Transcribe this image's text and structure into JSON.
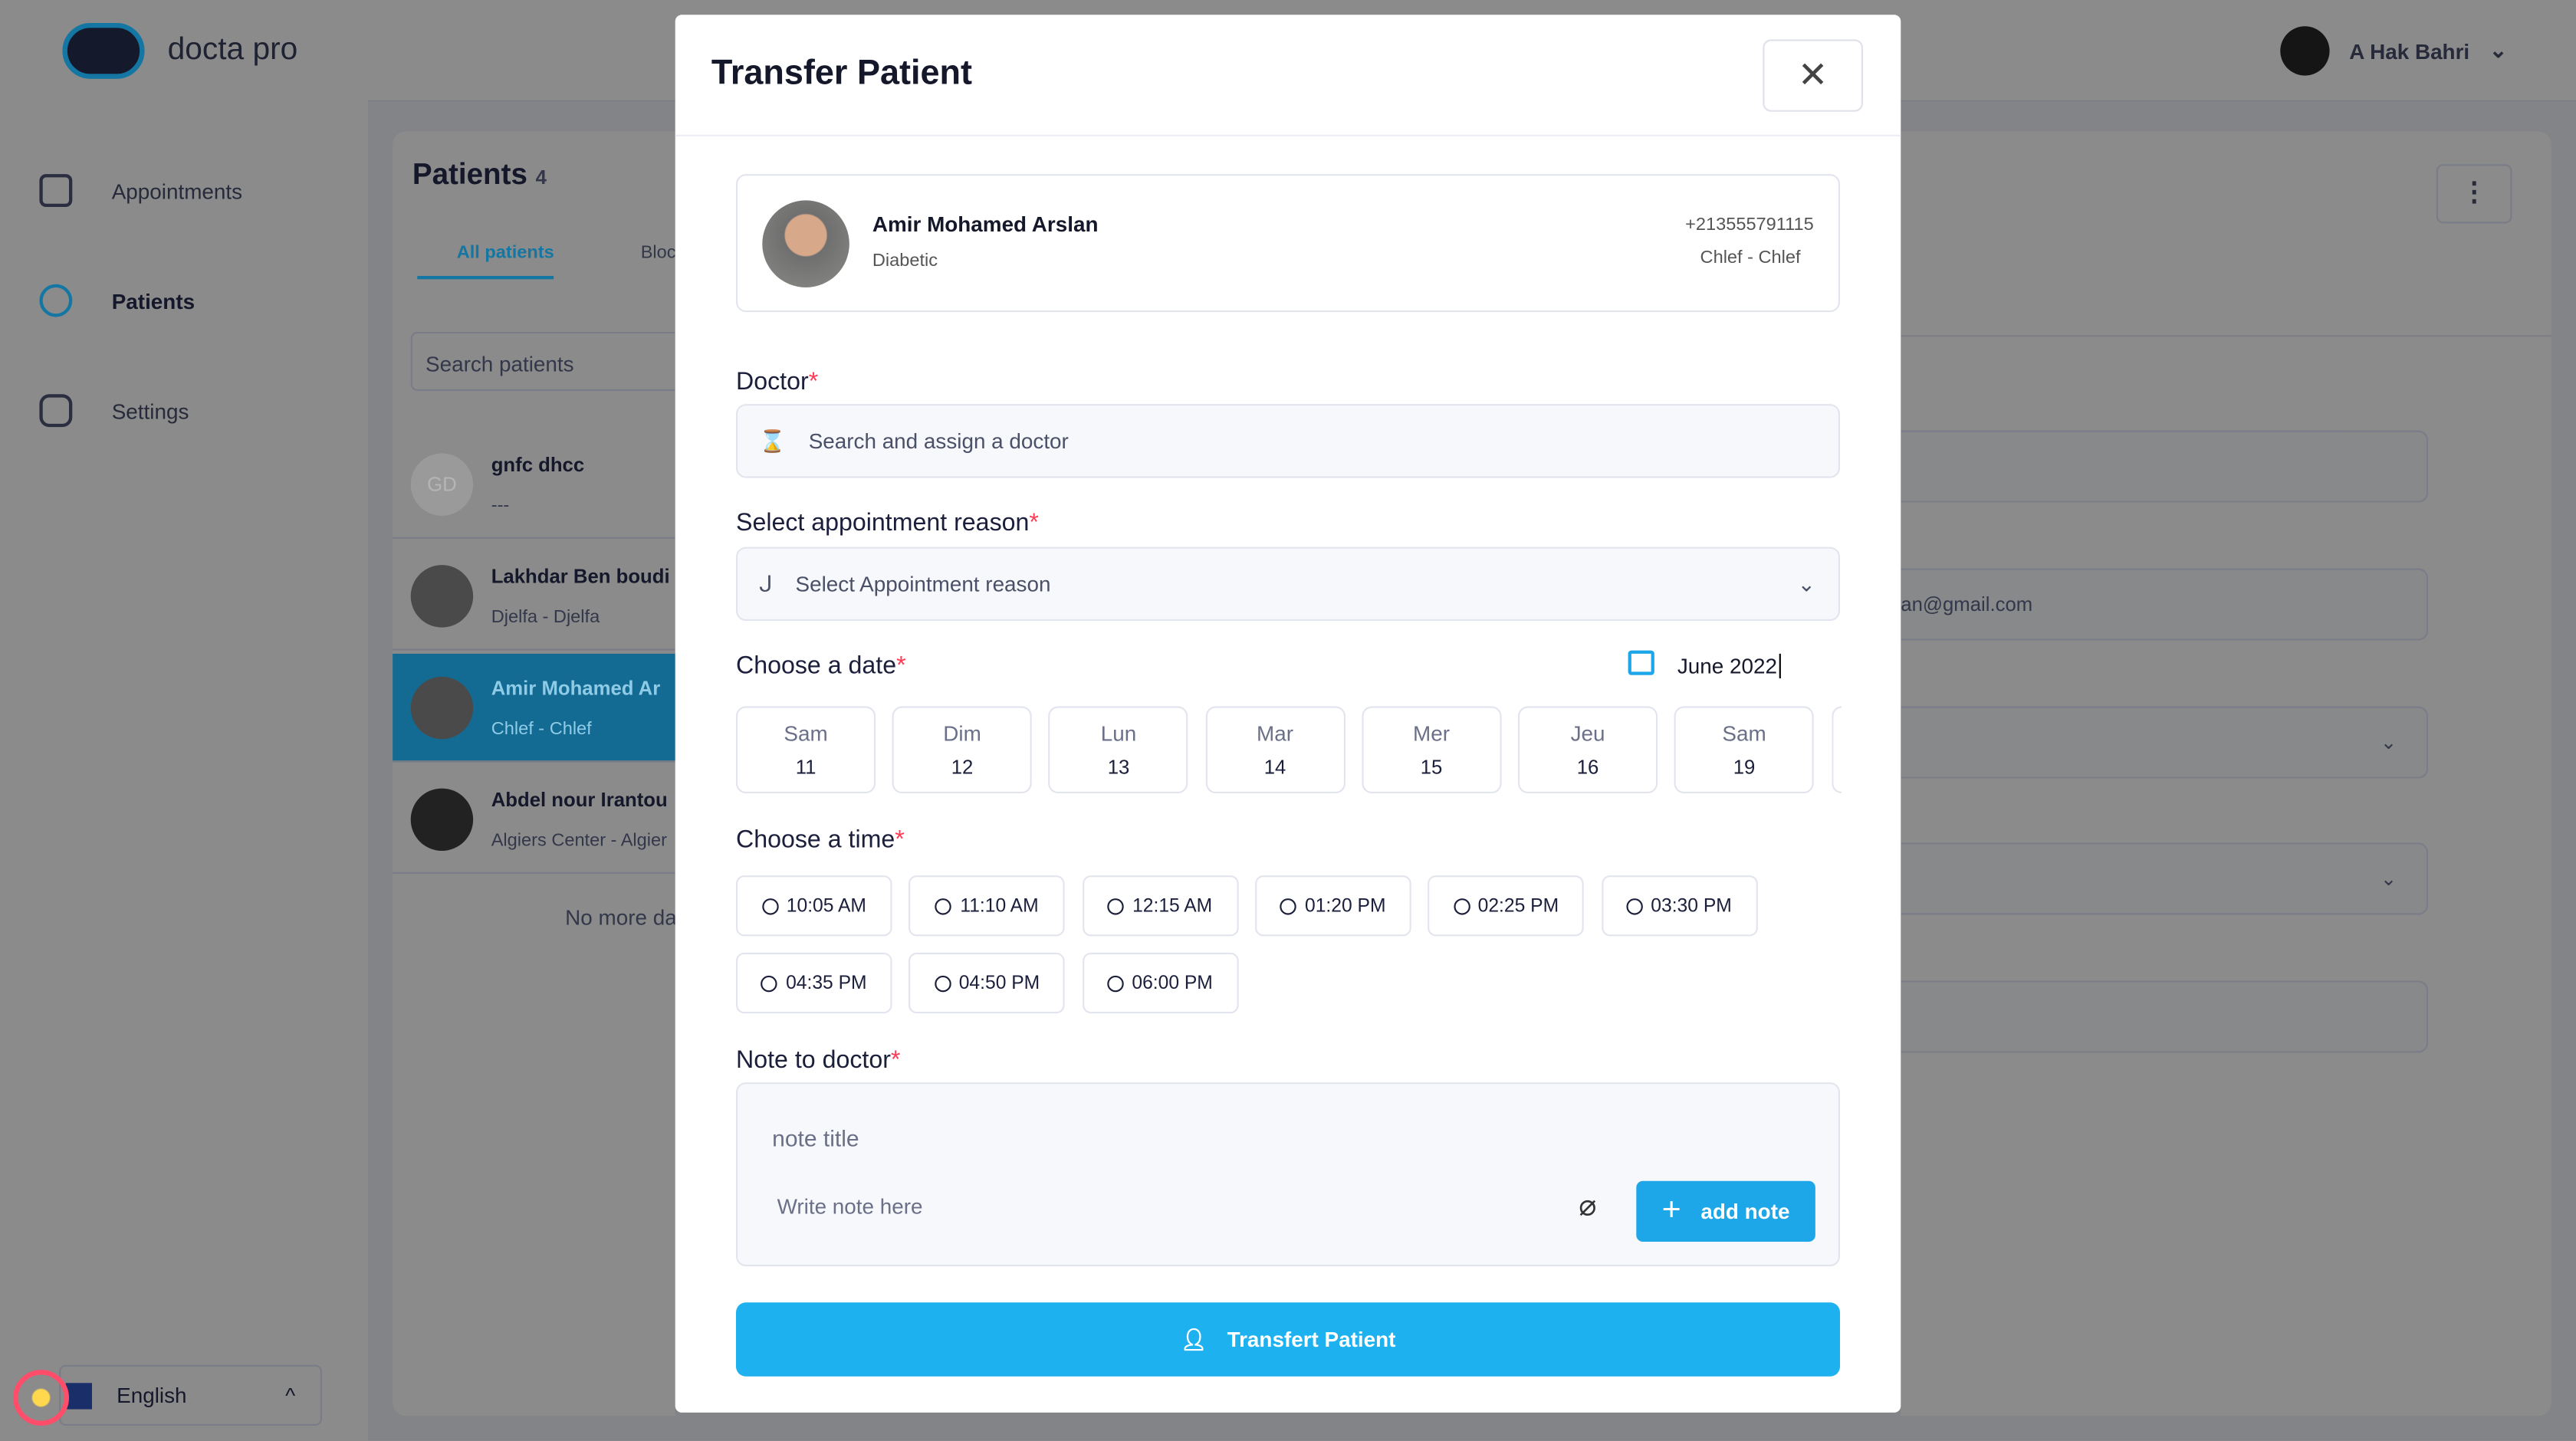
{
  "app": {
    "name": "docta pro",
    "user": "A Hak Bahri"
  },
  "sidebar": {
    "items": [
      {
        "label": "Appointments",
        "icon": "calendar-icon"
      },
      {
        "label": "Patients",
        "icon": "users-icon"
      },
      {
        "label": "Settings",
        "icon": "gear-icon"
      }
    ],
    "language": "English"
  },
  "patients": {
    "title": "Patients",
    "count": "4",
    "tabs": [
      "All patients",
      "Bloc"
    ],
    "search_placeholder": "Search patients",
    "items": [
      {
        "initials": "GD",
        "name": "gnfc dhcc",
        "sub": "---"
      },
      {
        "name": "Lakhdar Ben boudi",
        "sub": "Djelfa - Djelfa"
      },
      {
        "name": "Amir Mohamed Ar",
        "sub": "Chlef - Chlef",
        "selected": true
      },
      {
        "name": "Abdel nour Irantou",
        "sub": "Algiers Center - Algier"
      }
    ],
    "no_more": "No more da"
  },
  "detail": {
    "email": "an@gmail.com"
  },
  "modal": {
    "title": "Transfer Patient",
    "patient": {
      "name": "Amir Mohamed Arslan",
      "condition": "Diabetic",
      "phone": "+213555791115",
      "location": "Chlef - Chlef"
    },
    "doctor_label": "Doctor",
    "doctor_placeholder": "Search and assign a doctor",
    "reason_label": "Select appointment reason",
    "reason_placeholder": "Select Appointment reason",
    "date_label": "Choose a date",
    "month": "June 2022",
    "days": [
      {
        "d": "Sam",
        "n": "11"
      },
      {
        "d": "Dim",
        "n": "12"
      },
      {
        "d": "Lun",
        "n": "13"
      },
      {
        "d": "Mar",
        "n": "14"
      },
      {
        "d": "Mer",
        "n": "15"
      },
      {
        "d": "Jeu",
        "n": "16"
      },
      {
        "d": "Sam",
        "n": "19"
      }
    ],
    "time_label": "Choose a time",
    "times": [
      "10:05 AM",
      "11:10 AM",
      "12:15 AM",
      "01:20 PM",
      "02:25 PM",
      "03:30 PM",
      "04:35 PM",
      "04:50 PM",
      "06:00 PM"
    ],
    "note_label": "Note to doctor",
    "note_title_placeholder": "note title",
    "note_placeholder": "Write note here",
    "add_note": "add note",
    "submit": "Transfert Patient"
  },
  "colors": {
    "accent": "#1ea7e8",
    "required": "#ff3b55"
  }
}
